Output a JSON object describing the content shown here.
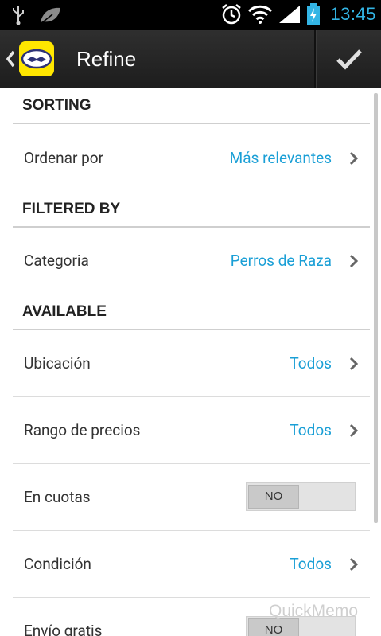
{
  "status_bar": {
    "time": "13:45",
    "icons": [
      "usb-icon",
      "leaf-icon",
      "alarm-icon",
      "wifi-icon",
      "signal-icon",
      "battery-charging-icon"
    ],
    "time_color": "#33b5e5"
  },
  "action_bar": {
    "title": "Refine",
    "back_icon": "chevron-left-icon",
    "logo": "app-logo",
    "done_icon": "checkmark-icon"
  },
  "sections": {
    "sorting": {
      "header": "SORTING",
      "ordenar": {
        "label": "Ordenar por",
        "value": "Más relevantes"
      }
    },
    "filtered_by": {
      "header": "FILTERED BY",
      "categoria": {
        "label": "Categoria",
        "value": "Perros de Raza"
      }
    },
    "available": {
      "header": "AVAILABLE",
      "ubicacion": {
        "label": "Ubicación",
        "value": "Todos"
      },
      "rango": {
        "label": "Rango de precios",
        "value": "Todos"
      },
      "cuotas": {
        "label": "En cuotas",
        "toggle": "NO"
      },
      "condicion": {
        "label": "Condición",
        "value": "Todos"
      },
      "envio": {
        "label": "Envío gratis",
        "toggle": "NO"
      }
    }
  },
  "watermark": "QuickMemo",
  "colors": {
    "accent": "#1a9fd6",
    "actionbar": "#262626",
    "logo": "#ffe600"
  }
}
